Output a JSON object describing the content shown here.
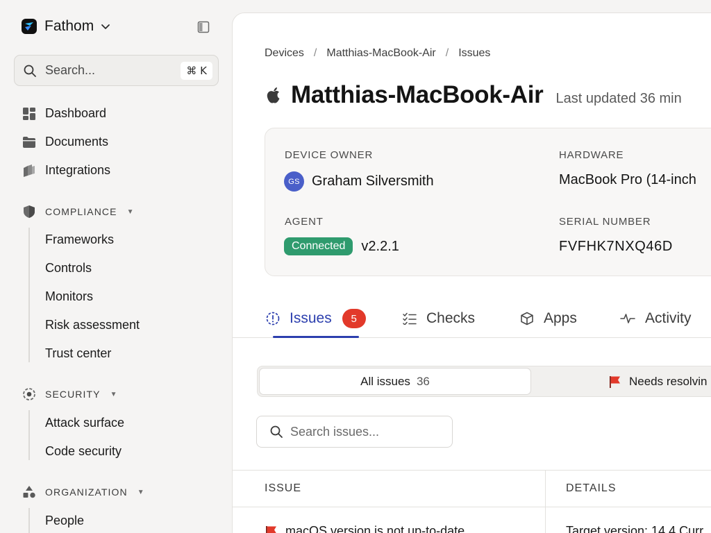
{
  "workspace": {
    "name": "Fathom"
  },
  "search": {
    "placeholder": "Search...",
    "shortcut": "⌘ K"
  },
  "nav": {
    "primary": [
      {
        "label": "Dashboard",
        "icon": "dashboard-grid-icon"
      },
      {
        "label": "Documents",
        "icon": "folder-icon"
      },
      {
        "label": "Integrations",
        "icon": "integrations-icon"
      }
    ],
    "compliance": {
      "label": "COMPLIANCE",
      "icon": "shield-icon",
      "items": [
        "Frameworks",
        "Controls",
        "Monitors",
        "Risk assessment",
        "Trust center"
      ]
    },
    "security": {
      "label": "SECURITY",
      "icon": "target-icon",
      "items": [
        "Attack surface",
        "Code security"
      ]
    },
    "organization": {
      "label": "ORGANIZATION",
      "icon": "shapes-icon",
      "items": [
        "People"
      ]
    }
  },
  "breadcrumb": [
    "Devices",
    "Matthias-MacBook-Air",
    "Issues"
  ],
  "device": {
    "name": "Matthias-MacBook-Air",
    "os_icon": "apple-icon",
    "last_updated": "Last updated 36 min",
    "owner_label": "DEVICE OWNER",
    "owner_initials": "GS",
    "owner_name": "Graham Silversmith",
    "hardware_label": "HARDWARE",
    "hardware_value": "MacBook Pro (14-inch",
    "agent_label": "AGENT",
    "agent_status": "Connected",
    "agent_version": "v2.2.1",
    "serial_label": "SERIAL NUMBER",
    "serial_value": "FVFHK7NXQ46D"
  },
  "tabs": [
    {
      "label": "Issues",
      "badge": "5",
      "active": true,
      "icon": "alert-circle-icon"
    },
    {
      "label": "Checks",
      "icon": "checklist-icon"
    },
    {
      "label": "Apps",
      "icon": "cube-icon"
    },
    {
      "label": "Activity",
      "icon": "activity-icon"
    }
  ],
  "filters": {
    "all_label": "All issues",
    "all_count": "36",
    "needs_label": "Needs resolvin",
    "needs_icon": "red-flag-icon"
  },
  "issue_search": {
    "placeholder": "Search issues..."
  },
  "table": {
    "headers": [
      "ISSUE",
      "DETAILS"
    ],
    "rows": [
      {
        "issue": "macOS version is not up-to-date",
        "details": "Target version: 14.4 Curr"
      }
    ]
  },
  "colors": {
    "accent": "#2c3fae",
    "success": "#2f9b6e",
    "danger": "#e2392a",
    "avatar": "#4a5fc9"
  }
}
